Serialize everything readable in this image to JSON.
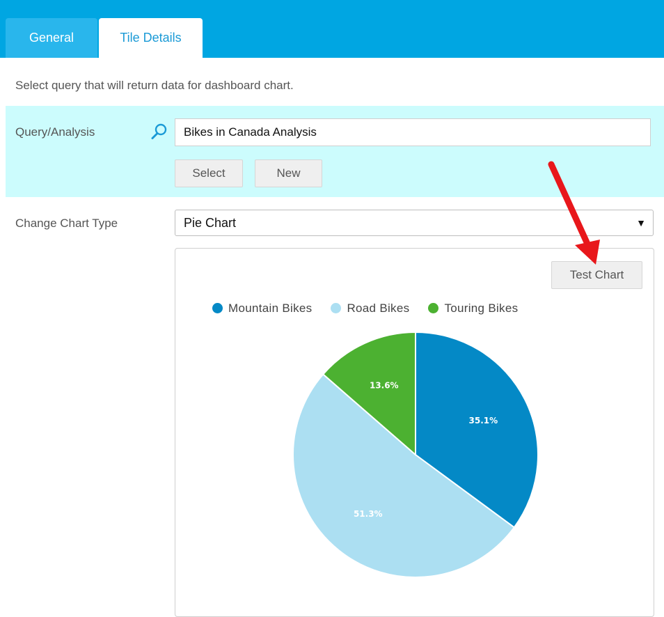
{
  "tabs": [
    {
      "label": "General",
      "active": false
    },
    {
      "label": "Tile Details",
      "active": true
    }
  ],
  "intro_text": "Select query that will return data for dashboard chart.",
  "query": {
    "label": "Query/Analysis",
    "value": "Bikes in Canada Analysis",
    "select_label": "Select",
    "new_label": "New"
  },
  "chart_type": {
    "label": "Change Chart Type",
    "selected": "Pie Chart"
  },
  "test_chart_label": "Test Chart",
  "colors": {
    "header": "#00a6e2",
    "panel": "#ccfcfd",
    "accent": "#1a9ad6"
  },
  "icons": [
    "search-icon",
    "dropdown-caret-icon",
    "red-arrow-annotation"
  ],
  "chart_data": {
    "type": "pie",
    "categories": [
      "Mountain Bikes",
      "Road Bikes",
      "Touring Bikes"
    ],
    "values": [
      35.1,
      51.3,
      13.6
    ],
    "labels": [
      "35.1%",
      "51.3%",
      "13.6%"
    ],
    "colors": [
      "#0489c6",
      "#acdff2",
      "#4cb131"
    ],
    "legend_position": "top",
    "start_angle": "12 o'clock, clockwise"
  }
}
